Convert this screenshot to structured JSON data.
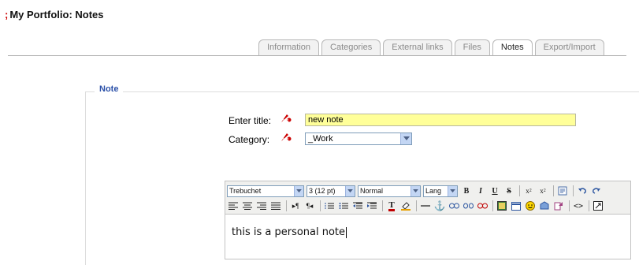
{
  "page": {
    "title": "My Portfolio: Notes"
  },
  "tabs": [
    {
      "label": "Information",
      "active": false
    },
    {
      "label": "Categories",
      "active": false
    },
    {
      "label": "External links",
      "active": false
    },
    {
      "label": "Files",
      "active": false
    },
    {
      "label": "Notes",
      "active": true
    },
    {
      "label": "Export/Import",
      "active": false
    }
  ],
  "note_form": {
    "legend": "Note",
    "title_label": "Enter title:",
    "title_value": "new note",
    "category_label": "Category:",
    "category_value": "_Work"
  },
  "editor": {
    "font_family": "Trebuchet",
    "font_size": "3 (12 pt)",
    "format": "Normal",
    "lang": "Lang",
    "content": "this is a personal note",
    "row1_buttons": [
      "bold-icon",
      "italic-icon",
      "underline-icon",
      "strikethrough-icon",
      "subscript-icon",
      "superscript-icon",
      "paste-word-icon",
      "undo-icon",
      "redo-icon"
    ],
    "row2_buttons": [
      "align-left-icon",
      "align-center-icon",
      "align-right-icon",
      "align-justify-icon",
      "ltr-icon",
      "rtl-icon",
      "ordered-list-icon",
      "unordered-list-icon",
      "outdent-icon",
      "indent-icon",
      "text-color-icon",
      "background-color-icon",
      "horizontal-rule-icon",
      "anchor-icon",
      "link-icon",
      "unlink-icon",
      "no-link-icon",
      "image-icon",
      "table-icon",
      "smiley-icon",
      "special-char-icon",
      "spellcheck-icon",
      "html-source-icon",
      "fullscreen-icon"
    ]
  },
  "colors": {
    "title_input_bg": "#ffff99",
    "legend_blue": "#2b50a8",
    "required_red": "#cc0000"
  }
}
